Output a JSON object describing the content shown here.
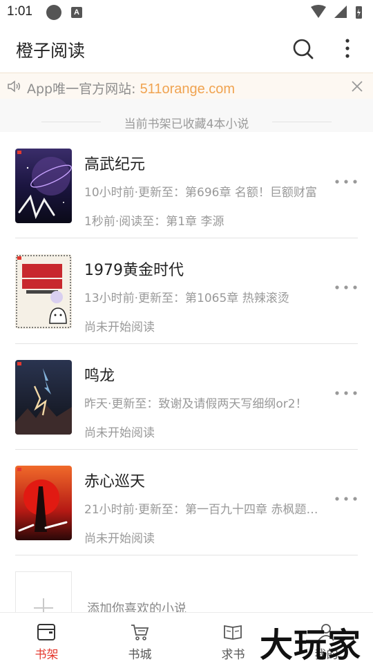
{
  "status_bar": {
    "time": "1:01",
    "a_icon": "A"
  },
  "app_bar": {
    "title": "橙子阅读",
    "search_icon": "search-icon",
    "more_icon": "more-vertical-icon"
  },
  "notice": {
    "text": "App唯一官方网站: ",
    "url": "511orange.com"
  },
  "shelf_count": "当前书架已收藏4本小说",
  "books": [
    {
      "title": "高武纪元",
      "update": "10小时前·更新至：第696章 名额！巨额财富",
      "read": "1秒前·阅读至：第1章 李源"
    },
    {
      "title": "1979黄金时代",
      "update": "13小时前·更新至：第1065章 热辣滚烫",
      "read": "尚未开始阅读"
    },
    {
      "title": "鸣龙",
      "update": "昨天·更新至：致谢及请假两天写细纲or2！",
      "read": "尚未开始阅读"
    },
    {
      "title": "赤心巡天",
      "update": "21小时前·更新至：第一百九十四章 赤枫题…",
      "read": "尚未开始阅读"
    }
  ],
  "add_book": {
    "label": "添加你喜欢的小说"
  },
  "tabs": [
    {
      "label": "书架",
      "icon": "bookshelf-icon",
      "active": true
    },
    {
      "label": "书城",
      "icon": "cart-icon",
      "active": false
    },
    {
      "label": "求书",
      "icon": "open-book-icon",
      "active": false
    },
    {
      "label": "我的",
      "icon": "person-icon",
      "active": false
    }
  ],
  "watermark": "大玩家",
  "colors": {
    "accent": "#e4392f",
    "notice_link": "#f0a350",
    "notice_bg": "#fdf8f2"
  }
}
